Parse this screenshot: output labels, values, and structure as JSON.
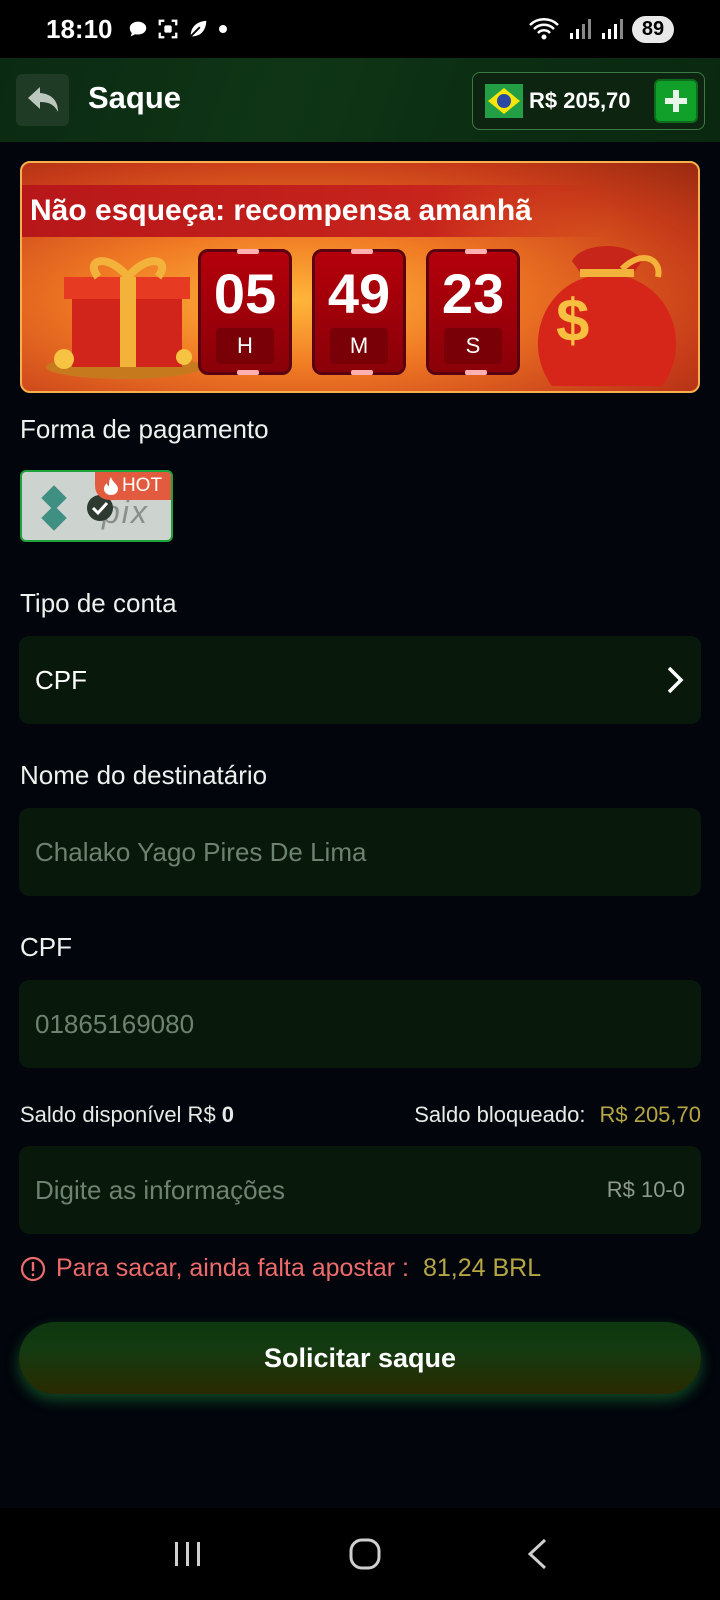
{
  "status_bar": {
    "time": "18:10",
    "battery": "89"
  },
  "header": {
    "title": "Saque",
    "balance": "R$ 205,70"
  },
  "banner": {
    "title": "Não esqueça: recompensa amanhã",
    "countdown": [
      {
        "value": "05",
        "unit": "H"
      },
      {
        "value": "49",
        "unit": "M"
      },
      {
        "value": "23",
        "unit": "S"
      }
    ]
  },
  "payment": {
    "label": "Forma de pagamento",
    "option_badge": "HOT",
    "option_name": "pix"
  },
  "account_type": {
    "label": "Tipo de conta",
    "value": "CPF"
  },
  "recipient": {
    "label": "Nome do destinatário",
    "value": "Chalako Yago Pires De Lima"
  },
  "cpf": {
    "label": "CPF",
    "value": "01865169080"
  },
  "saldo": {
    "available_label": "Saldo disponível R$",
    "available_amount": "0",
    "blocked_label": "Saldo bloqueado:",
    "blocked_amount": "R$ 205,70"
  },
  "amount_input": {
    "placeholder": "Digite as informações",
    "suffix": "R$ 10-0"
  },
  "warning": {
    "text": "Para sacar, ainda falta apostar :",
    "amount": "81,24 BRL"
  },
  "submit": {
    "label": "Solicitar saque"
  },
  "colors": {
    "accent_green": "#11a02a",
    "warning_red": "#ee6b6b",
    "gold": "#b5a644",
    "banner_red": "#b4000b"
  }
}
